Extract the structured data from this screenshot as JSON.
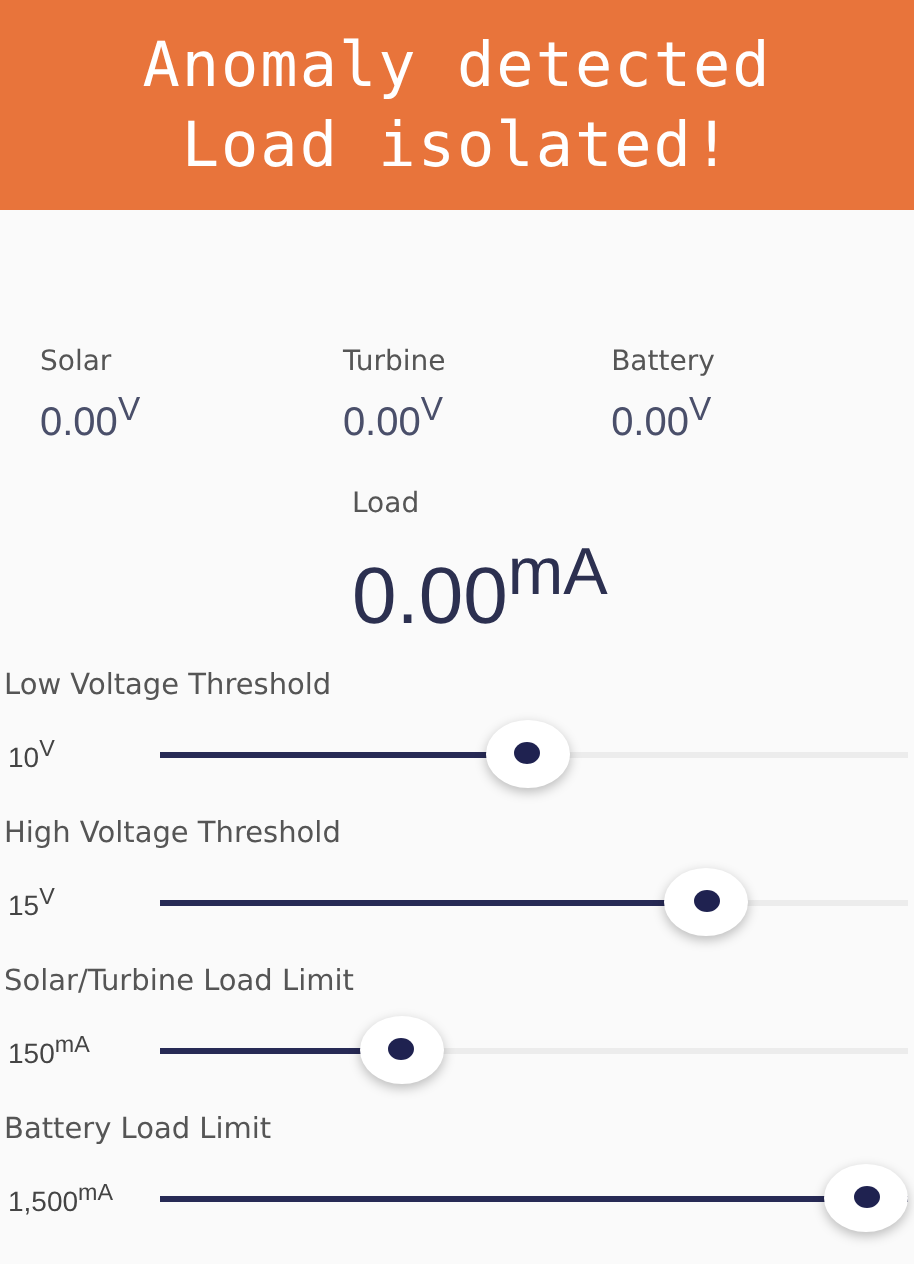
{
  "alert": {
    "lines": [
      "Anomaly detected",
      "Load isolated!"
    ]
  },
  "readings": [
    {
      "label": "Solar",
      "value": "0.00$^{V}$"
    },
    {
      "label": "Turbine",
      "value": "0.00$^{V}$"
    },
    {
      "label": "Battery",
      "value": "0.00$^{V}$"
    }
  ],
  "load": {
    "label": "Load",
    "value": "0.00$^{mA}$"
  },
  "sliders": [
    {
      "label": "Low Voltage Threshold",
      "value": "10$^{V}$",
      "level": 0.49
    },
    {
      "label": "High Voltage Threshold",
      "value": "15$^{V}$",
      "level": 0.76
    },
    {
      "label": "Solar/Turbine Load Limit",
      "value": "150$^{mA}$",
      "level": 0.3
    },
    {
      "label": "Battery Load Limit",
      "value": "1,500$^{mA}$",
      "level": 1.0
    }
  ]
}
